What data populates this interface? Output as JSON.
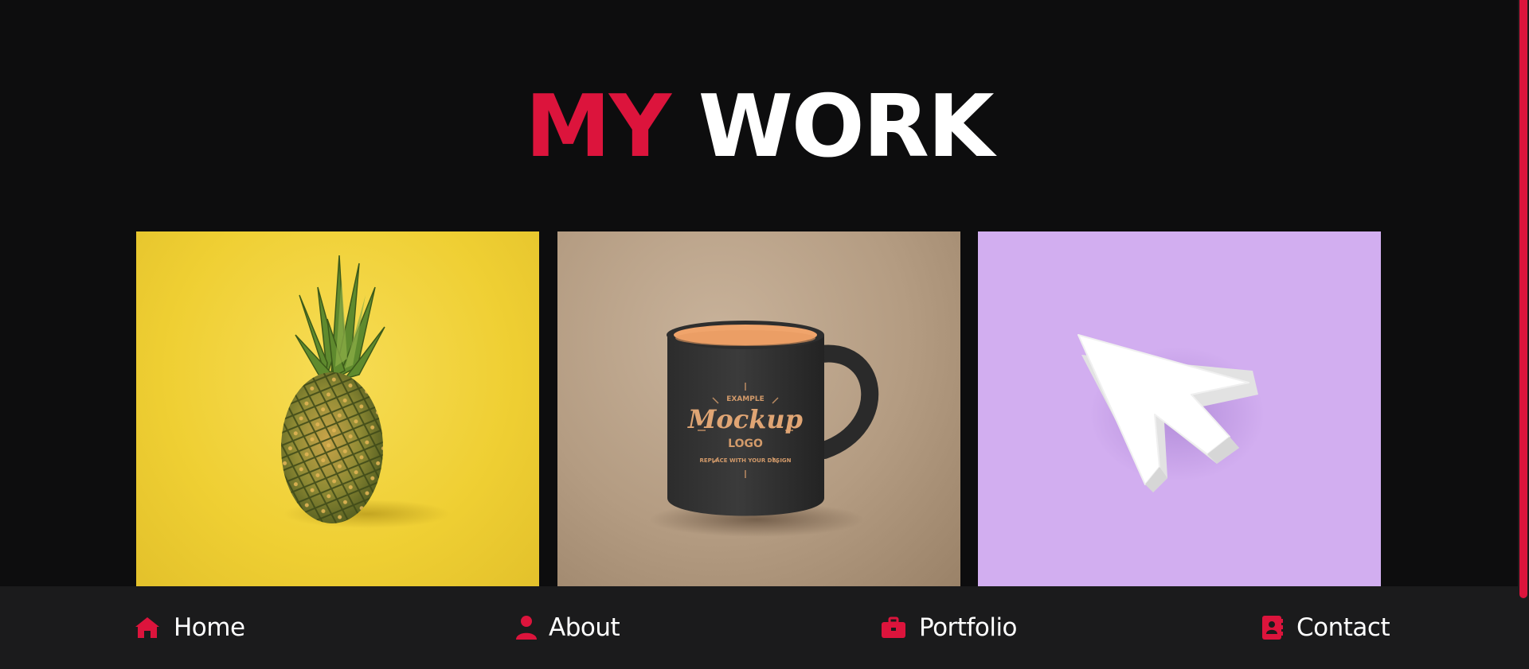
{
  "heading": {
    "accent": "MY",
    "rest": "WORK"
  },
  "portfolio": {
    "items": [
      {
        "subject": "pineapple",
        "background_color": "#efcf33"
      },
      {
        "subject": "mug",
        "logo_lines": [
          "EXAMPLE",
          "Mockup",
          "LOGO",
          "REPLACE WITH YOUR DESIGN"
        ],
        "background_color": "#b49c82"
      },
      {
        "subject": "cursor",
        "background_color": "#d2aef0"
      }
    ]
  },
  "nav": {
    "items": [
      {
        "label": "Home",
        "icon": "home-icon"
      },
      {
        "label": "About",
        "icon": "user-icon"
      },
      {
        "label": "Portfolio",
        "icon": "briefcase-icon"
      },
      {
        "label": "Contact",
        "icon": "address-book-icon"
      }
    ]
  },
  "colors": {
    "accent": "#dc143c",
    "background": "#0d0d0e",
    "nav_background": "#1b1b1c",
    "text": "#ffffff"
  }
}
